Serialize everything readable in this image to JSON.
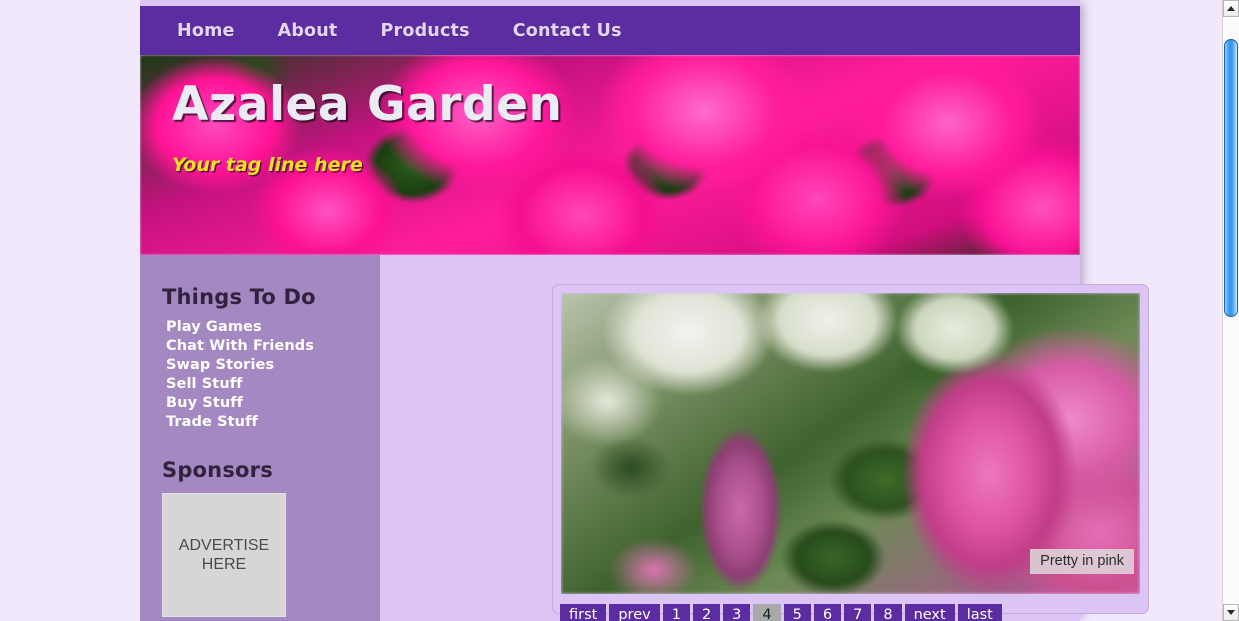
{
  "site": {
    "nav": {
      "items": [
        {
          "label": "Home"
        },
        {
          "label": "About"
        },
        {
          "label": "Products"
        },
        {
          "label": "Contact Us"
        }
      ]
    },
    "banner": {
      "title": "Azalea Garden",
      "tagline": "Your tag line here",
      "image_alt": "pink azalea flowers banner"
    },
    "sidebar": {
      "things_heading": "Things To Do",
      "things_items": [
        {
          "label": "Play Games"
        },
        {
          "label": "Chat With Friends"
        },
        {
          "label": "Swap Stories"
        },
        {
          "label": "Sell Stuff"
        },
        {
          "label": "Buy Stuff"
        },
        {
          "label": "Trade Stuff"
        }
      ],
      "sponsors_heading": "Sponsors",
      "advert": {
        "line1": "ADVERTISE",
        "line2": "HERE"
      }
    },
    "gallery": {
      "image_alt": "close-up of a pink azalea blossom with bud",
      "caption": "Pretty in pink",
      "pagination": [
        {
          "label": "first",
          "current": false
        },
        {
          "label": "prev",
          "current": false
        },
        {
          "label": "1",
          "current": false
        },
        {
          "label": "2",
          "current": false
        },
        {
          "label": "3",
          "current": false
        },
        {
          "label": "4",
          "current": true
        },
        {
          "label": "5",
          "current": false
        },
        {
          "label": "6",
          "current": false
        },
        {
          "label": "7",
          "current": false
        },
        {
          "label": "8",
          "current": false
        },
        {
          "label": "next",
          "current": false
        },
        {
          "label": "last",
          "current": false
        }
      ]
    }
  },
  "colors": {
    "nav_purple": "#5c2da0",
    "sidebar_purple": "#a388c2",
    "content_lavender": "#dcc4f5",
    "page_background": "#f1e8fb",
    "tagline_yellow": "#f4e122",
    "current_page_grey": "#a9a9a9",
    "scrollbar_thumb_blue": "#2f93ec"
  },
  "scrollbar": {
    "up_arrow": "triangle-up-icon",
    "down_arrow": "triangle-down-icon"
  }
}
